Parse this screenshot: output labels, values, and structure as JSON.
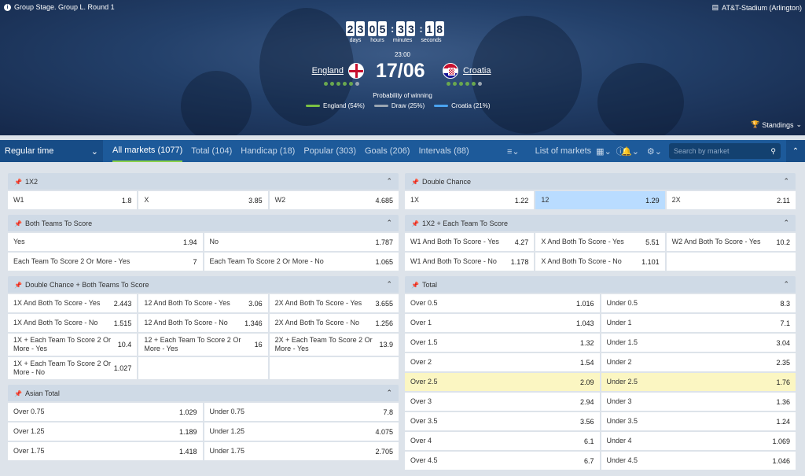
{
  "header": {
    "stage": "Group Stage. Group L. Round 1",
    "stadium": "AT&T-Stadium (Arlington)",
    "countdown": [
      {
        "digits": [
          "2",
          "3"
        ],
        "label": "days"
      },
      {
        "digits": [
          "0",
          "5"
        ],
        "label": "hours"
      },
      {
        "digits": [
          "3",
          "3"
        ],
        "label": "minutes"
      },
      {
        "digits": [
          "1",
          "8"
        ],
        "label": "seconds"
      }
    ],
    "time": "23:00",
    "date": "17/06",
    "team1": "England",
    "team2": "Croatia",
    "prob_title": "Probability of winning",
    "prob": [
      {
        "label": "England (54%)",
        "color": "#7ac143"
      },
      {
        "label": "Draw (25%)",
        "color": "#9aa5b1"
      },
      {
        "label": "Croatia (21%)",
        "color": "#4aa3f0"
      }
    ],
    "form1": [
      "#6aa84f",
      "#6aa84f",
      "#6aa84f",
      "#6aa84f",
      "#6aa84f",
      "#9aa5b1"
    ],
    "form2": [
      "#6aa84f",
      "#6aa84f",
      "#6aa84f",
      "#6aa84f",
      "#6aa84f",
      "#9aa5b1"
    ],
    "standings": "Standings"
  },
  "nav": {
    "period": "Regular time",
    "tabs": [
      "All markets (1077)",
      "Total (104)",
      "Handicap (18)",
      "Popular (303)",
      "Goals (206)",
      "Intervals (88)"
    ],
    "list": "List of markets",
    "search_placeholder": "Search by market"
  },
  "markets": {
    "m1x2": {
      "title": "1X2",
      "cells": [
        [
          "W1",
          "1.8"
        ],
        [
          "X",
          "3.85"
        ],
        [
          "W2",
          "4.685"
        ]
      ]
    },
    "btts": {
      "title": "Both Teams To Score",
      "cells": [
        [
          "Yes",
          "1.94"
        ],
        [
          "No",
          "1.787"
        ],
        [
          "Each Team To Score 2 Or More - Yes",
          "7"
        ],
        [
          "Each Team To Score 2 Or More - No",
          "1.065"
        ]
      ]
    },
    "dcbtts": {
      "title": "Double Chance + Both Teams To Score",
      "cells": [
        [
          "1X And Both To Score - Yes",
          "2.443"
        ],
        [
          "12 And Both To Score - Yes",
          "3.06"
        ],
        [
          "2X And Both To Score - Yes",
          "3.655"
        ],
        [
          "1X And Both To Score - No",
          "1.515"
        ],
        [
          "12 And Both To Score - No",
          "1.346"
        ],
        [
          "2X And Both To Score - No",
          "1.256"
        ],
        [
          "1X + Each Team To Score 2 Or More - Yes",
          "10.4"
        ],
        [
          "12 + Each Team To Score 2 Or More - Yes",
          "16"
        ],
        [
          "2X + Each Team To Score 2 Or More - Yes",
          "13.9"
        ],
        [
          "1X + Each Team To Score 2 Or More - No",
          "1.027"
        ]
      ]
    },
    "asian": {
      "title": "Asian Total",
      "cells": [
        [
          "Over 0.75",
          "1.029"
        ],
        [
          "Under 0.75",
          "7.8"
        ],
        [
          "Over 1.25",
          "1.189"
        ],
        [
          "Under 1.25",
          "4.075"
        ],
        [
          "Over 1.75",
          "1.418"
        ],
        [
          "Under 1.75",
          "2.705"
        ]
      ]
    },
    "dc": {
      "title": "Double Chance",
      "cells": [
        [
          "1X",
          "1.22"
        ],
        [
          "12",
          "1.29"
        ],
        [
          "2X",
          "2.11"
        ]
      ]
    },
    "x2each": {
      "title": "1X2 + Each Team To Score",
      "cells": [
        [
          "W1 And Both To Score - Yes",
          "4.27"
        ],
        [
          "X And Both To Score - Yes",
          "5.51"
        ],
        [
          "W2 And Both To Score - Yes",
          "10.2"
        ],
        [
          "W1 And Both To Score - No",
          "1.178"
        ],
        [
          "X And Both To Score - No",
          "1.101"
        ]
      ]
    },
    "total": {
      "title": "Total",
      "cells": [
        [
          "Over 0.5",
          "1.016"
        ],
        [
          "Under 0.5",
          "8.3"
        ],
        [
          "Over 1",
          "1.043"
        ],
        [
          "Under 1",
          "7.1"
        ],
        [
          "Over 1.5",
          "1.32"
        ],
        [
          "Under 1.5",
          "3.04"
        ],
        [
          "Over 2",
          "1.54"
        ],
        [
          "Under 2",
          "2.35"
        ],
        [
          "Over 2.5",
          "2.09"
        ],
        [
          "Under 2.5",
          "1.76"
        ],
        [
          "Over 3",
          "2.94"
        ],
        [
          "Under 3",
          "1.36"
        ],
        [
          "Over 3.5",
          "3.56"
        ],
        [
          "Under 3.5",
          "1.24"
        ],
        [
          "Over 4",
          "6.1"
        ],
        [
          "Under 4",
          "1.069"
        ],
        [
          "Over 4.5",
          "6.7"
        ],
        [
          "Under 4.5",
          "1.046"
        ]
      ]
    }
  }
}
